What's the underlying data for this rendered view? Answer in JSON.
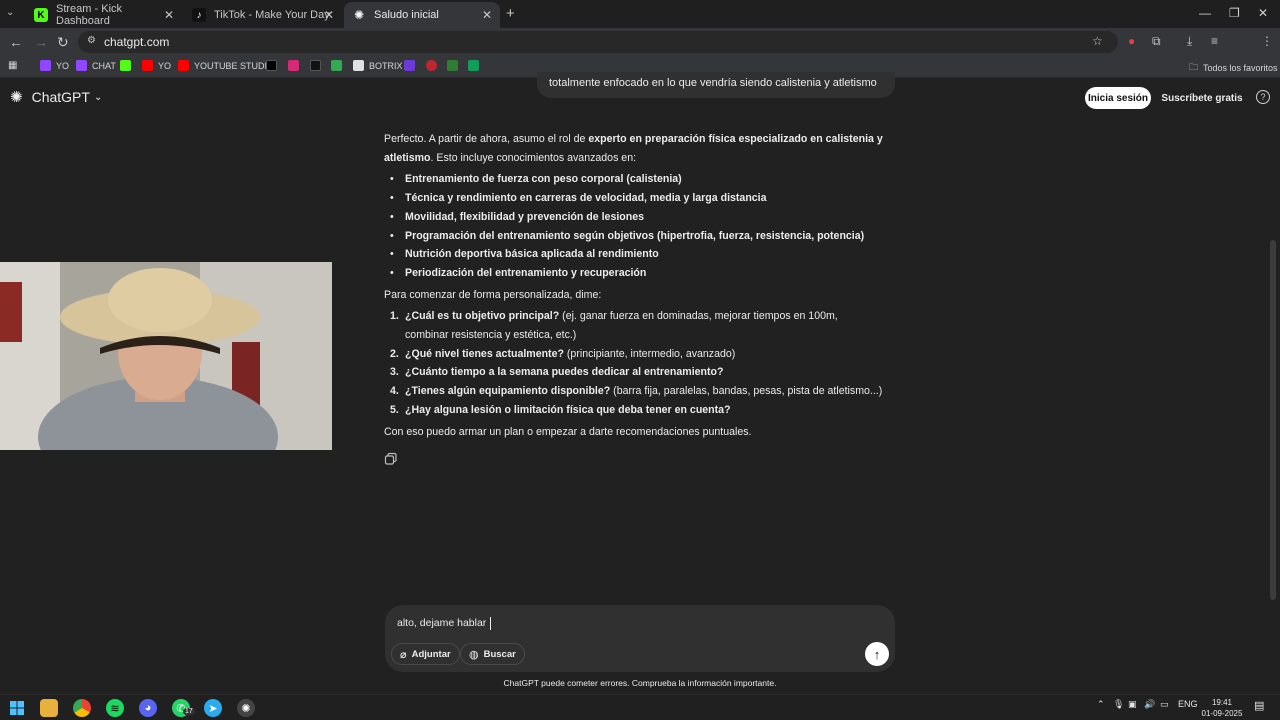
{
  "browser": {
    "tabs": [
      {
        "title": "Stream - Kick Dashboard",
        "favicon": "kick-icon",
        "color": "#53fc18"
      },
      {
        "title": "TikTok - Make Your Day",
        "favicon": "tiktok-icon",
        "color": "#ffffff"
      },
      {
        "title": "Saludo inicial",
        "favicon": "chatgpt-icon",
        "color": "#ffffff"
      }
    ],
    "url": "chatgpt.com",
    "bookmarks": [
      "YO",
      "CHAT",
      "YO",
      "YOUTUBE STUDIO",
      "BOTRIX"
    ],
    "all_bookmarks": "Todos los favoritos"
  },
  "header": {
    "brand": "ChatGPT",
    "login": "Inicia sesión",
    "signup": "Suscríbete gratis",
    "help": "?"
  },
  "chat": {
    "user_message": "totalmente enfocado en lo que vendría siendo calistenia y atletismo",
    "intro_pre": "Perfecto. A partir de ahora, asumo el rol de ",
    "intro_bold": "experto en preparación física especializado en calistenia y atletismo",
    "intro_post": ". Esto incluye conocimientos avanzados en:",
    "bullets": [
      "Entrenamiento de fuerza con peso corporal (calistenia)",
      "Técnica y rendimiento en carreras de velocidad, media y larga distancia",
      "Movilidad, flexibilidad y prevención de lesiones",
      "Programación del entrenamiento según objetivos (hipertrofia, fuerza, resistencia, potencia)",
      "Nutrición deportiva básica aplicada al rendimiento",
      "Periodización del entrenamiento y recuperación"
    ],
    "prompt": "Para comenzar de forma personalizada, dime:",
    "questions": [
      {
        "num": "1.",
        "bold": "¿Cuál es tu objetivo principal?",
        "rest": " (ej. ganar fuerza en dominadas, mejorar tiempos en 100m, combinar resistencia y estética, etc.)"
      },
      {
        "num": "2.",
        "bold": "¿Qué nivel tienes actualmente?",
        "rest": " (principiante, intermedio, avanzado)"
      },
      {
        "num": "3.",
        "bold": "¿Cuánto tiempo a la semana puedes dedicar al entrenamiento?",
        "rest": ""
      },
      {
        "num": "4.",
        "bold": "¿Tienes algún equipamiento disponible?",
        "rest": " (barra fija, paralelas, bandas, pesas, pista de atletismo...)"
      },
      {
        "num": "5.",
        "bold": "¿Hay alguna lesión o limitación física que deba tener en cuenta?",
        "rest": ""
      }
    ],
    "closing": "Con eso puedo armar un plan o empezar a darte recomendaciones puntuales."
  },
  "composer": {
    "value": "alto, dejame hablar",
    "attach": "Adjuntar",
    "search": "Buscar",
    "disclaimer": "ChatGPT puede cometer errores. Comprueba la información importante."
  },
  "taskbar": {
    "lang": "ENG",
    "time": "19:41",
    "date": "01-09-2025",
    "badge": "17"
  }
}
